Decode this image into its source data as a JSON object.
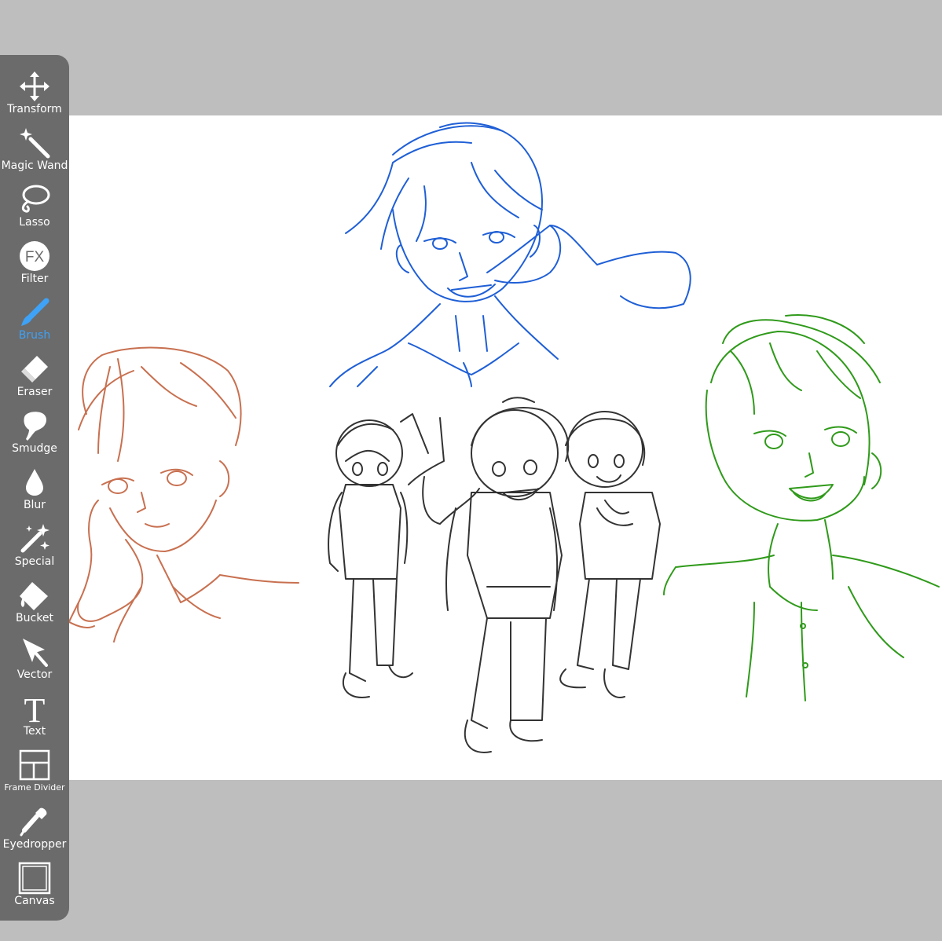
{
  "toolbar": {
    "active_tool": "Brush",
    "active_color": "#3ea2f7",
    "tools": [
      {
        "label": "Transform",
        "icon": "move-arrows-icon"
      },
      {
        "label": "Magic Wand",
        "icon": "magic-wand-icon"
      },
      {
        "label": "Lasso",
        "icon": "lasso-icon"
      },
      {
        "label": "Filter",
        "icon": "fx-icon",
        "icon_text": "FX"
      },
      {
        "label": "Brush",
        "icon": "brush-icon"
      },
      {
        "label": "Eraser",
        "icon": "eraser-icon"
      },
      {
        "label": "Smudge",
        "icon": "smudge-icon"
      },
      {
        "label": "Blur",
        "icon": "blur-drop-icon"
      },
      {
        "label": "Special",
        "icon": "special-sparkle-icon"
      },
      {
        "label": "Bucket",
        "icon": "bucket-icon"
      },
      {
        "label": "Vector",
        "icon": "vector-cursor-icon"
      },
      {
        "label": "Text",
        "icon": "text-t-icon",
        "icon_text": "T"
      },
      {
        "label": "Frame Divider",
        "icon": "frame-divider-icon"
      },
      {
        "label": "Eyedropper",
        "icon": "eyedropper-icon"
      },
      {
        "label": "Canvas",
        "icon": "canvas-icon"
      }
    ]
  },
  "canvas": {
    "sketch_colors": {
      "blue": "#1f5fd6",
      "orange": "#c87050",
      "black": "#333333",
      "green": "#2f9a1a"
    }
  }
}
